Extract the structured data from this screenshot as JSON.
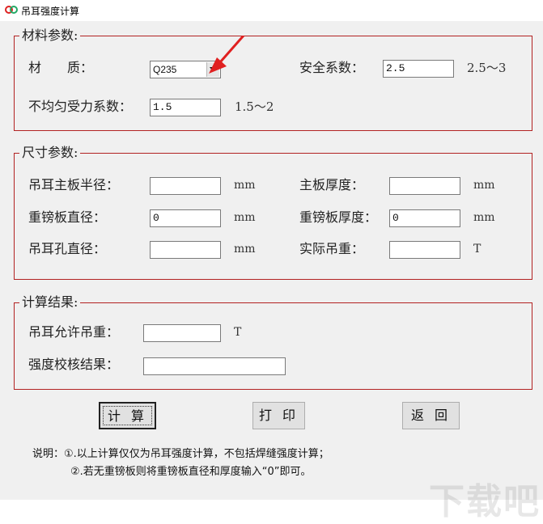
{
  "window": {
    "title": "吊耳强度计算"
  },
  "material": {
    "legend": "材料参数:",
    "material_label": "材　　质：",
    "material_value": "Q235",
    "safety_label": "安全系数：",
    "safety_value": "2.5",
    "safety_range": "2.5～3",
    "uneven_label": "不均匀受力系数：",
    "uneven_value": "1.5",
    "uneven_range": "1.5～2"
  },
  "size": {
    "legend": "尺寸参数:",
    "main_radius_label": "吊耳主板半径：",
    "main_radius_value": "",
    "main_thickness_label": "主板厚度：",
    "main_thickness_value": "",
    "pad_diameter_label": "重镑板直径：",
    "pad_diameter_value": "0",
    "pad_thickness_label": "重镑板厚度：",
    "pad_thickness_value": "0",
    "hole_diameter_label": "吊耳孔直径：",
    "hole_diameter_value": "",
    "actual_load_label": "实际吊重：",
    "actual_load_value": "",
    "unit_mm": "mm",
    "unit_t": "T"
  },
  "result": {
    "legend": "计算结果:",
    "allowed_label": "吊耳允许吊重：",
    "allowed_value": "",
    "allowed_unit": "T",
    "check_label": "强度校核结果：",
    "check_value": ""
  },
  "buttons": {
    "calculate": "计 算",
    "print": "打 印",
    "back": "返 回"
  },
  "notes": {
    "line1": "说明：①.以上计算仅仅为吊耳强度计算，不包括焊缝强度计算；",
    "line2": "②.若无重镑板则将重镑板直径和厚度输入“0”即可。"
  },
  "watermark": "下载吧",
  "colors": {
    "group_border": "#b22222",
    "arrow": "#e02020",
    "client_bg": "#f0f0f0"
  }
}
